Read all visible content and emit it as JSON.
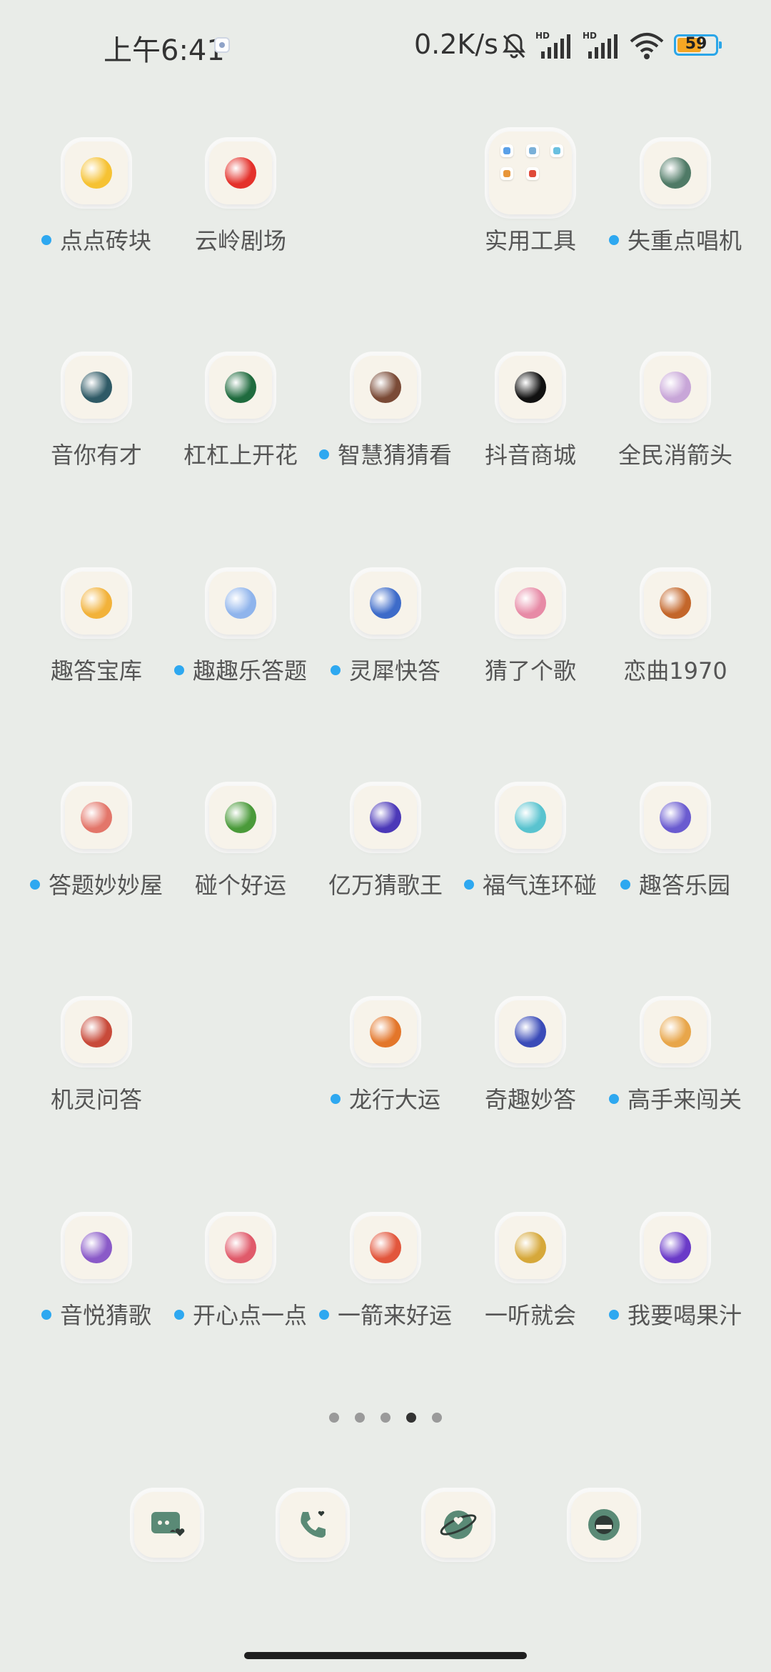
{
  "status_bar": {
    "time": "上午6:41",
    "network_speed": "0.2K/s",
    "battery_level": "59",
    "icons": [
      "notification-dot-icon",
      "mute-bell-icon",
      "hd-signal-icon",
      "hd-signal-icon",
      "wifi-icon",
      "battery-icon"
    ]
  },
  "apps": [
    {
      "label": "点点砖块",
      "new": true,
      "icon": "chick-game-icon",
      "color": "#f6c233"
    },
    {
      "label": "云岭剧场",
      "new": false,
      "icon": "theater-icon",
      "color": "#e4312b"
    },
    {
      "label": "实用工具",
      "new": false,
      "icon": "folder-icon",
      "color": "#f7f3ea"
    },
    {
      "label": "失重点唱机",
      "new": true,
      "icon": "jukebox-icon",
      "color": "#4f7a66"
    },
    {
      "label": "音你有才",
      "new": false,
      "icon": "music-quiz-icon",
      "color": "#2f5a66"
    },
    {
      "label": "杠杠上开花",
      "new": false,
      "icon": "mahjong-icon",
      "color": "#1f6b3e"
    },
    {
      "label": "智慧猜猜看",
      "new": true,
      "icon": "guess-icon",
      "color": "#7a4a36"
    },
    {
      "label": "抖音商城",
      "new": false,
      "icon": "douyin-mall-icon",
      "color": "#111111"
    },
    {
      "label": "全民消箭头",
      "new": false,
      "icon": "arrow-icon",
      "color": "#c8a6d8"
    },
    {
      "label": "趣答宝库",
      "new": false,
      "icon": "treasure-icon",
      "color": "#f2b23a"
    },
    {
      "label": "趣趣乐答题",
      "new": true,
      "icon": "quiz-card-icon",
      "color": "#8fb4ec"
    },
    {
      "label": "灵犀快答",
      "new": true,
      "icon": "character-icon",
      "color": "#3d6bc9"
    },
    {
      "label": "猜了个歌",
      "new": false,
      "icon": "song-guess-icon",
      "color": "#e78aa6"
    },
    {
      "label": "恋曲1970",
      "new": false,
      "icon": "retro-music-icon",
      "color": "#c3662a"
    },
    {
      "label": "答题妙妙屋",
      "new": true,
      "icon": "cartoon-girl-icon",
      "color": "#e3766a"
    },
    {
      "label": "碰个好运",
      "new": false,
      "icon": "watermelon-icon",
      "color": "#4a9a3a"
    },
    {
      "label": "亿万猜歌王",
      "new": false,
      "icon": "music-disc-icon",
      "color": "#4b38b8"
    },
    {
      "label": "福气连环碰",
      "new": true,
      "icon": "watermelon-slice-icon",
      "color": "#59c3cf"
    },
    {
      "label": "趣答乐园",
      "new": true,
      "icon": "girl-character-icon",
      "color": "#6a5bd0"
    },
    {
      "label": "机灵问答",
      "new": false,
      "icon": "boy-character-icon",
      "color": "#c84a3a"
    },
    {
      "label": "龙行大运",
      "new": true,
      "icon": "dragon-icon",
      "color": "#e3762a"
    },
    {
      "label": "奇趣妙答",
      "new": false,
      "icon": "rocket-icon",
      "color": "#3a4bb8"
    },
    {
      "label": "高手来闯关",
      "new": true,
      "icon": "shiba-icon",
      "color": "#e8a64a"
    },
    {
      "label": "音悦猜歌",
      "new": true,
      "icon": "purple-music-icon",
      "color": "#8a5ac8"
    },
    {
      "label": "开心点一点",
      "new": true,
      "icon": "balloon-icon",
      "color": "#e05a6a"
    },
    {
      "label": "一箭来好运",
      "new": true,
      "icon": "bow-arrow-icon",
      "color": "#e2563c"
    },
    {
      "label": "一听就会",
      "new": false,
      "icon": "animal-band-icon",
      "color": "#d6a83a"
    },
    {
      "label": "我要喝果汁",
      "new": true,
      "icon": "juice-icon",
      "color": "#6a3ac8"
    }
  ],
  "pager": {
    "count": 5,
    "active_index": 3
  },
  "dock": [
    {
      "icon": "messages-icon",
      "color": "#5a8a76"
    },
    {
      "icon": "phone-icon",
      "color": "#5a8a76"
    },
    {
      "icon": "browser-icon",
      "color": "#5a8a76"
    },
    {
      "icon": "camera-icon",
      "color": "#5a8a76"
    }
  ]
}
